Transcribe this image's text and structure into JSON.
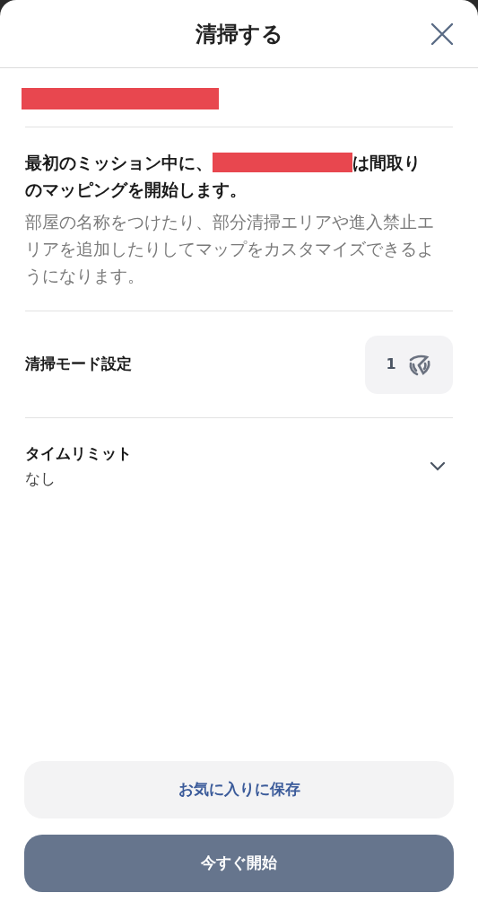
{
  "header": {
    "title": "清掃する"
  },
  "intro": {
    "heading_start": "最初のミッション中に、",
    "heading_end": "は間取り",
    "heading_line2": "のマッピングを開始します。",
    "body": "部屋の名称をつけたり、部分清掃エリアや進入禁止エリアを追加したりしてマップをカスタマイズできるようになります。"
  },
  "cleaning_mode": {
    "label": "清掃モード設定",
    "value": "1"
  },
  "time_limit": {
    "label": "タイムリミット",
    "value": "なし",
    "expanded": false
  },
  "buttons": [
    {
      "kind": "secondary",
      "label": "お気に入りに保存"
    },
    {
      "kind": "primary",
      "label": "今すぐ開始"
    }
  ]
}
